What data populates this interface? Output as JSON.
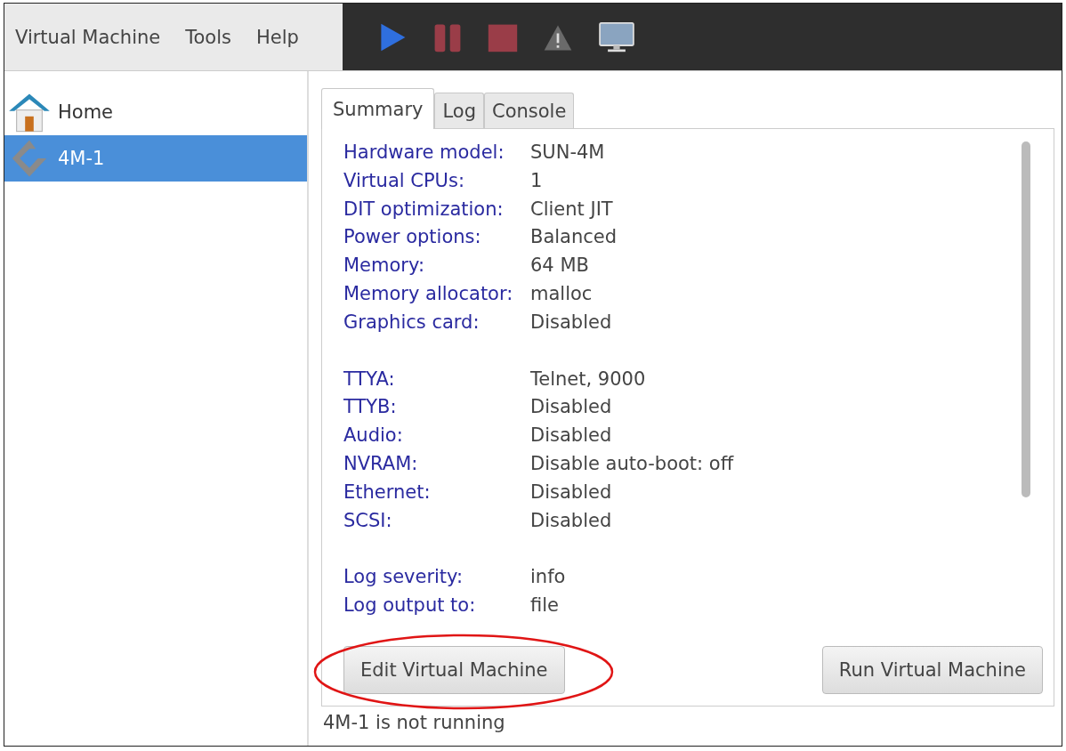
{
  "menu": [
    "Virtual Machine",
    "Tools",
    "Help"
  ],
  "sidebar": {
    "items": [
      {
        "label": "Home",
        "kind": "home",
        "selected": false
      },
      {
        "label": "4M-1",
        "kind": "machine",
        "selected": true
      }
    ]
  },
  "tabs": [
    {
      "label": "Summary",
      "selected": true
    },
    {
      "label": "Log",
      "selected": false
    },
    {
      "label": "Console",
      "selected": false
    }
  ],
  "summary": [
    [
      {
        "label": "Hardware model:",
        "value": "SUN-4M"
      },
      {
        "label": "Virtual CPUs:",
        "value": "1"
      },
      {
        "label": "DIT optimization:",
        "value": "Client JIT"
      },
      {
        "label": "Power options:",
        "value": "Balanced"
      },
      {
        "label": "Memory:",
        "value": "64 MB"
      },
      {
        "label": "Memory allocator:",
        "value": "malloc"
      },
      {
        "label": "Graphics card:",
        "value": "Disabled"
      }
    ],
    [
      {
        "label": "TTYA:",
        "value": "Telnet, 9000"
      },
      {
        "label": "TTYB:",
        "value": "Disabled"
      },
      {
        "label": "Audio:",
        "value": "Disabled"
      },
      {
        "label": "NVRAM:",
        "value": "Disable auto-boot: off"
      },
      {
        "label": "Ethernet:",
        "value": "Disabled"
      },
      {
        "label": "SCSI:",
        "value": "Disabled"
      }
    ],
    [
      {
        "label": "Log severity:",
        "value": "info"
      },
      {
        "label": "Log output to:",
        "value": "file"
      }
    ]
  ],
  "buttons": [
    "Edit Virtual Machine",
    "Run Virtual Machine"
  ],
  "status_bar": "4M-1 is not running"
}
